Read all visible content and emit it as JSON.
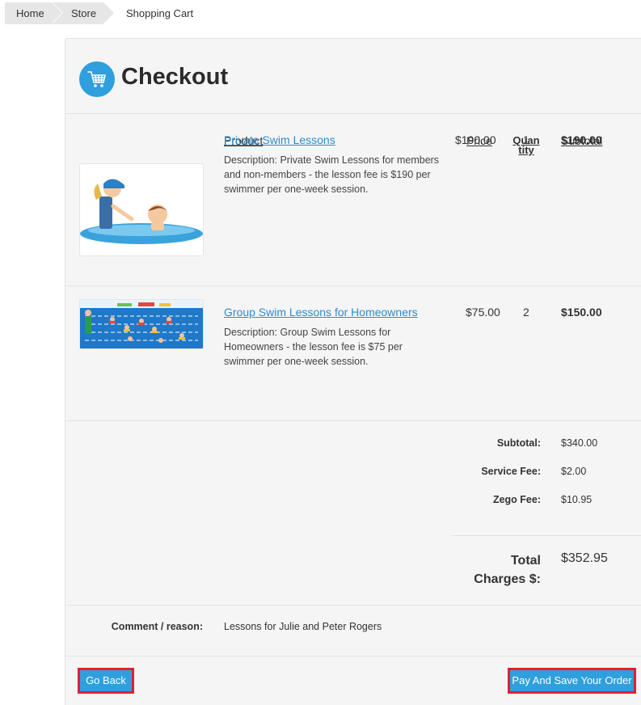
{
  "breadcrumb": {
    "home": "Home",
    "store": "Store",
    "current": "Shopping Cart"
  },
  "page": {
    "title": "Checkout",
    "icon": "shopping-cart-icon",
    "accent": "#2f9fdd"
  },
  "columns": {
    "product": "Product",
    "price": "Price",
    "qty_line1": "Quan",
    "qty_line2": "tity",
    "subtotal": "Subtotal"
  },
  "items": [
    {
      "name": "Private Swim Lessons",
      "description": "Description: Private Swim Lessons for members and non-members - the lesson fee is $190 per swimmer per one-week session.",
      "price": "$190.00",
      "qty": "1",
      "subtotal": "$190.00"
    },
    {
      "name": "Group Swim Lessons for Homeowners",
      "description": "Description: Group Swim Lessons for Homeowners - the lesson fee is $75 per swimmer per one-week session.",
      "price": "$75.00",
      "qty": "2",
      "subtotal": "$150.00"
    }
  ],
  "summary": {
    "subtotal_label": "Subtotal:",
    "subtotal": "$340.00",
    "service_label": "Service Fee:",
    "service": "$2.00",
    "zego_label": "Zego Fee:",
    "zego": "$10.95",
    "total_line1": "Total",
    "total_line2": "Charges $:",
    "total": "$352.95"
  },
  "comment": {
    "label": "Comment / reason:",
    "value": "Lessons for Julie and Peter Rogers"
  },
  "buttons": {
    "back": "Go Back",
    "pay": "Pay And Save Your Order",
    "highlight": "#e02030"
  }
}
